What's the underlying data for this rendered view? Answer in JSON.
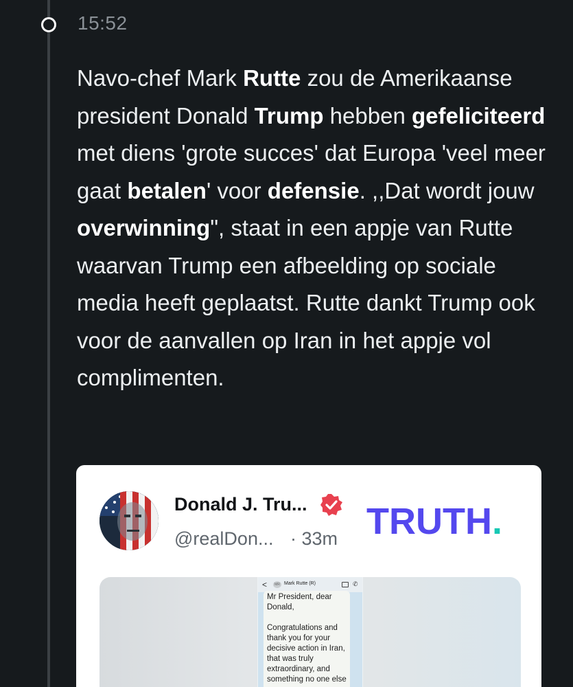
{
  "timeline": {
    "timestamp": "15:52"
  },
  "article": {
    "segments": [
      {
        "text": "Navo-chef Mark ",
        "bold": false
      },
      {
        "text": "Rutte",
        "bold": true
      },
      {
        "text": " zou de Amerikaanse president Donald ",
        "bold": false
      },
      {
        "text": "Trump",
        "bold": true
      },
      {
        "text": " hebben ",
        "bold": false
      },
      {
        "text": "gefeliciteerd",
        "bold": true
      },
      {
        "text": " met diens 'grote succes' dat Europa 'veel meer gaat ",
        "bold": false
      },
      {
        "text": "betalen",
        "bold": true
      },
      {
        "text": "' voor ",
        "bold": false
      },
      {
        "text": "defensie",
        "bold": true
      },
      {
        "text": ". ,,Dat wordt jouw ",
        "bold": false
      },
      {
        "text": "overwinning",
        "bold": true
      },
      {
        "text": "\", staat in een appje van Rutte waarvan Trump een afbeelding op sociale media heeft geplaatst. Rutte dankt Trump ook voor de aanvallen op Iran in het appje vol complimenten.",
        "bold": false
      }
    ]
  },
  "embed": {
    "display_name": "Donald J. Tru...",
    "handle": "@realDon...",
    "time_separator": "·",
    "time": "33m",
    "logo_text": "TRUTH",
    "logo_dot": ".",
    "verified_icon": "verified-badge-icon",
    "colors": {
      "logo": "#5448ee",
      "logo_dot": "#17c8b4",
      "verified": "#e8414f"
    },
    "screenshot": {
      "back_icon": "<",
      "contact_initials": "MR",
      "contact_name": "Mark Rutte",
      "contact_mark": "(R)",
      "call_icon": "✆",
      "message_lines": [
        "Mr President, dear Donald,",
        "Congratulations and thank you for your decisive action in Iran, that was truly extraordinary, and something no one else"
      ]
    }
  }
}
